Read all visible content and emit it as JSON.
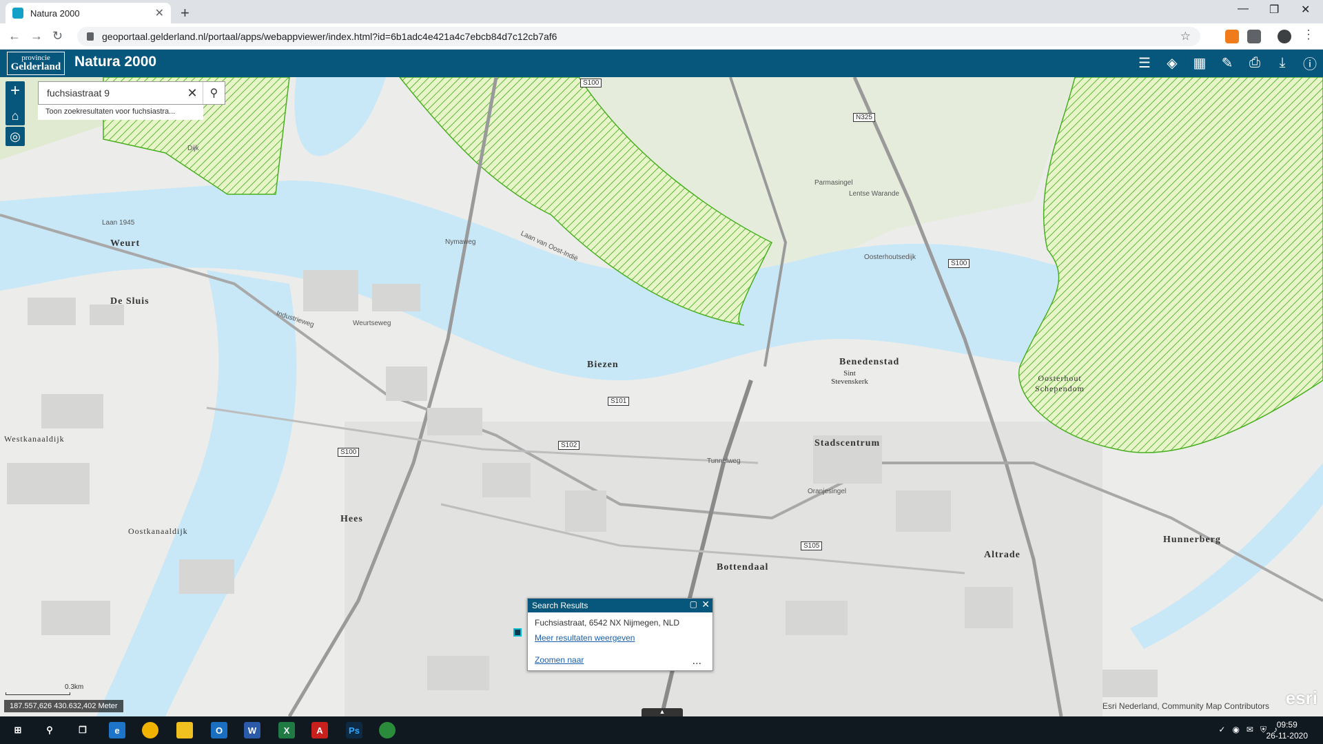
{
  "browser": {
    "tab_title": "Natura 2000",
    "url": "geoportaal.gelderland.nl/portaal/apps/webappviewer/index.html?id=6b1adc4e421a4c7ebcb84d7c12cb7af6"
  },
  "app": {
    "logo_line1": "provincie",
    "logo_line2": "Gelderland",
    "title": "Natura 2000"
  },
  "search": {
    "value": "fuchsiastraat 9",
    "suggestion": "Toon zoekresultaten voor fuchsiastra..."
  },
  "map_labels": {
    "weurt": "Weurt",
    "de_sluis": "De Sluis",
    "westkanaaldijk": "Westkanaaldijk",
    "oostkanaaldijk": "Oostkanaaldijk",
    "hees": "Hees",
    "biezen": "Biezen",
    "benedenstad": "Benedenstad",
    "sint_stevenskerk": "Sint Stevenskerk",
    "oosterhout_schependom": "Oosterhout Schependom",
    "stadscentrum": "Stadscentrum",
    "altrade": "Altrade",
    "bottendaal": "Bottendaal",
    "hunnerberg": "Hunnerberg"
  },
  "streets": {
    "industrieweg": "Industrieweg",
    "weurtseweg": "Weurtseweg",
    "nymaweg": "Nymaweg",
    "laan_van_oost_indie": "Laan van Oost-Indië",
    "tunnelweg": "Tunnelweg",
    "oranjesingel": "Oranjesingel",
    "parmasingel": "Parmasingel",
    "lentse_warande": "Lentse Warande",
    "oosterhoutsedijk": "Oosterhoutsedijk",
    "dijk": "Dijk",
    "laan_1945": "Laan 1945"
  },
  "shields": {
    "s100a": "S100",
    "s100b": "S100",
    "s100c": "S100",
    "n325": "N325",
    "s101": "S101",
    "s102": "S102",
    "s105": "S105"
  },
  "popup": {
    "title": "Search Results",
    "address": "Fuchsiastraat, 6542 NX Nijmegen, NLD",
    "more_link": "Meer resultaten weergeven",
    "zoom_link": "Zoomen naar",
    "dots": "..."
  },
  "scale": {
    "label": "0.3km"
  },
  "coords": "187.557,626 430.632,402 Meter",
  "attribution": "Esri Nederland, Community Map Contributors",
  "esri": "esri",
  "taskbar": {
    "time": "09:59",
    "date": "26-11-2020"
  },
  "colors": {
    "appbar": "#07567c",
    "water": "#c9e8f7",
    "natura": "#7ccd4a"
  }
}
